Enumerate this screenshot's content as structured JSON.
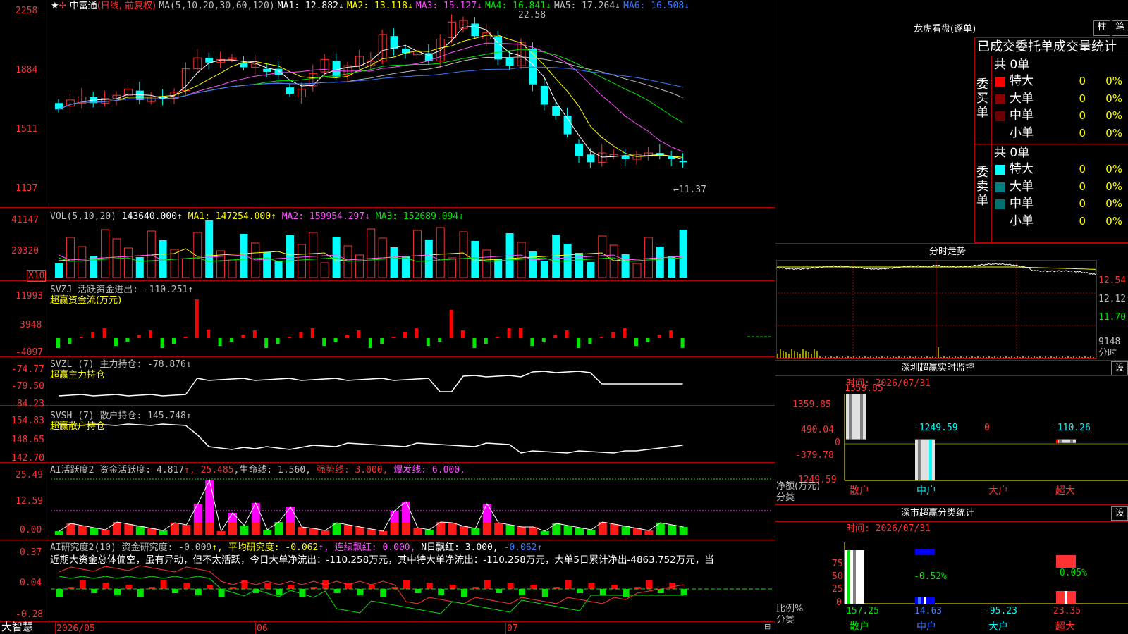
{
  "stock": {
    "name": "中富通",
    "mode": "(日线, 前复权)",
    "ma_label": "MA(5,10,20,30,60,120)",
    "ma": [
      {
        "text": "MA1: 12.882↓",
        "color": "#ffffff"
      },
      {
        "text": "MA2: 13.118↓",
        "color": "#ffff00"
      },
      {
        "text": "MA3: 15.127↓",
        "color": "#ff50ff"
      },
      {
        "text": "MA4: 16.841↓",
        "color": "#00e600"
      },
      {
        "text": "MA5: 17.264↓",
        "color": "#c0c0c0"
      },
      {
        "text": "MA6: 16.508↓",
        "color": "#3c78ff"
      }
    ],
    "price_axis": [
      "2258",
      "1884",
      "1511",
      "1137"
    ],
    "high_label": "22.58",
    "low_label": "←11.37"
  },
  "vol": {
    "label": "VOL(5,10,20)",
    "value": "143640.000↑",
    "ma": [
      {
        "text": "MA1: 147254.000↑",
        "color": "#ffff00"
      },
      {
        "text": "MA2: 159954.297↓",
        "color": "#ff50ff"
      },
      {
        "text": "MA3: 152689.094↓",
        "color": "#00e600"
      }
    ],
    "axis": [
      "41147",
      "20320"
    ],
    "unit": "X10"
  },
  "svzj": {
    "label": "SVZJ  活跃资金进出: -110.251↑",
    "sub": "超赢资金流(万元)",
    "axis": [
      "11993",
      "3948",
      "-4097"
    ]
  },
  "svzl": {
    "label": "SVZL (7) 主力持仓: -78.876↓",
    "sub": "超赢主力持仓",
    "axis": [
      "-74.77",
      "-79.50",
      "-84.23"
    ]
  },
  "svsh": {
    "label": "SVSH (7) 散户持仓: 145.748↑",
    "sub": "超赢散户持仓",
    "axis": [
      "154.83",
      "148.65",
      "142.70"
    ]
  },
  "ai_active": {
    "label": "AI活跃度2 资金活跃度: 4.817",
    "v2": "↑, 25.485",
    "v3": ",生命线: 1.560,",
    "v4": "强势线: 3.000,",
    "v5": "爆发线: 6.000,",
    "axis": [
      "25.49",
      "12.59",
      "0.00"
    ]
  },
  "ai_research": {
    "label": "AI研究度2(10) 资金研究度: -0.009",
    "v2": "↑, 平均研究度: -0.062",
    "v3": "↑, 连续飘红: 0.000,",
    "v4": "N日飘红: 3.000,",
    "v5": "-0.062↑",
    "text": "近期大资金总体偏空，虽有异动，但不太活跃，今日大单净流出：-110.258万元，其中特大单净流出：-110.258万元，大单5日累计净出-4863.752万元，当",
    "axis": [
      "0.37",
      "0.04",
      "-0.28"
    ]
  },
  "date_axis": [
    "2026/05",
    "06",
    "07"
  ],
  "logo": "大智慧",
  "dragon": {
    "title": "龙虎看盘(逐单)",
    "btn1": "柱",
    "btn2": "笔",
    "header": "已成交委托单成交量统计",
    "buy_label": "委买单",
    "sell_label": "委卖单",
    "buy_total": "共 0单",
    "sell_total": "共 0单",
    "buy_rows": [
      {
        "name": "特大",
        "color": "#ff0000",
        "count": "0",
        "pct": "0%"
      },
      {
        "name": "大单",
        "color": "#8b0000",
        "count": "0",
        "pct": "0%"
      },
      {
        "name": "中单",
        "color": "#6b0000",
        "count": "0",
        "pct": "0%"
      },
      {
        "name": "小单",
        "color": "#000000",
        "count": "0",
        "pct": "0%"
      }
    ],
    "sell_rows": [
      {
        "name": "特大",
        "color": "#00ffff",
        "count": "0",
        "pct": "0%"
      },
      {
        "name": "大单",
        "color": "#008080",
        "count": "0",
        "pct": "0%"
      },
      {
        "name": "中单",
        "color": "#007070",
        "count": "0",
        "pct": "0%"
      },
      {
        "name": "小单",
        "color": "#000000",
        "count": "0",
        "pct": "0%"
      }
    ]
  },
  "minute": {
    "title": "分时走势",
    "axis": [
      "12.54",
      "12.12",
      "11.70",
      "9148"
    ],
    "unit": "分时"
  },
  "monitor": {
    "title": "深圳超赢实时监控",
    "btn": "设",
    "time": "时间: 2026/07/31",
    "axis": [
      "1359.85",
      "490.04",
      "0",
      "-379.78",
      "-1249.59"
    ],
    "ylabel": "净额(万元)",
    "xlabel": "分类",
    "values": [
      "1359.85",
      "-1249.59",
      "0",
      "-110.26"
    ],
    "categories": [
      "散户",
      "中户",
      "大户",
      "超大"
    ]
  },
  "classify": {
    "title": "深市超赢分类统计",
    "btn": "设",
    "time": "时间: 2026/07/31",
    "axis": [
      "75",
      "50",
      "25",
      "0"
    ],
    "ylabel": "比例%",
    "xlabel": "分类",
    "top_labels": [
      "-0.52%",
      "-0.05%"
    ],
    "values": [
      "157.25",
      "14.63",
      "-95.23",
      "23.35"
    ],
    "categories": [
      "散户",
      "中户",
      "大户",
      "超大"
    ]
  }
}
